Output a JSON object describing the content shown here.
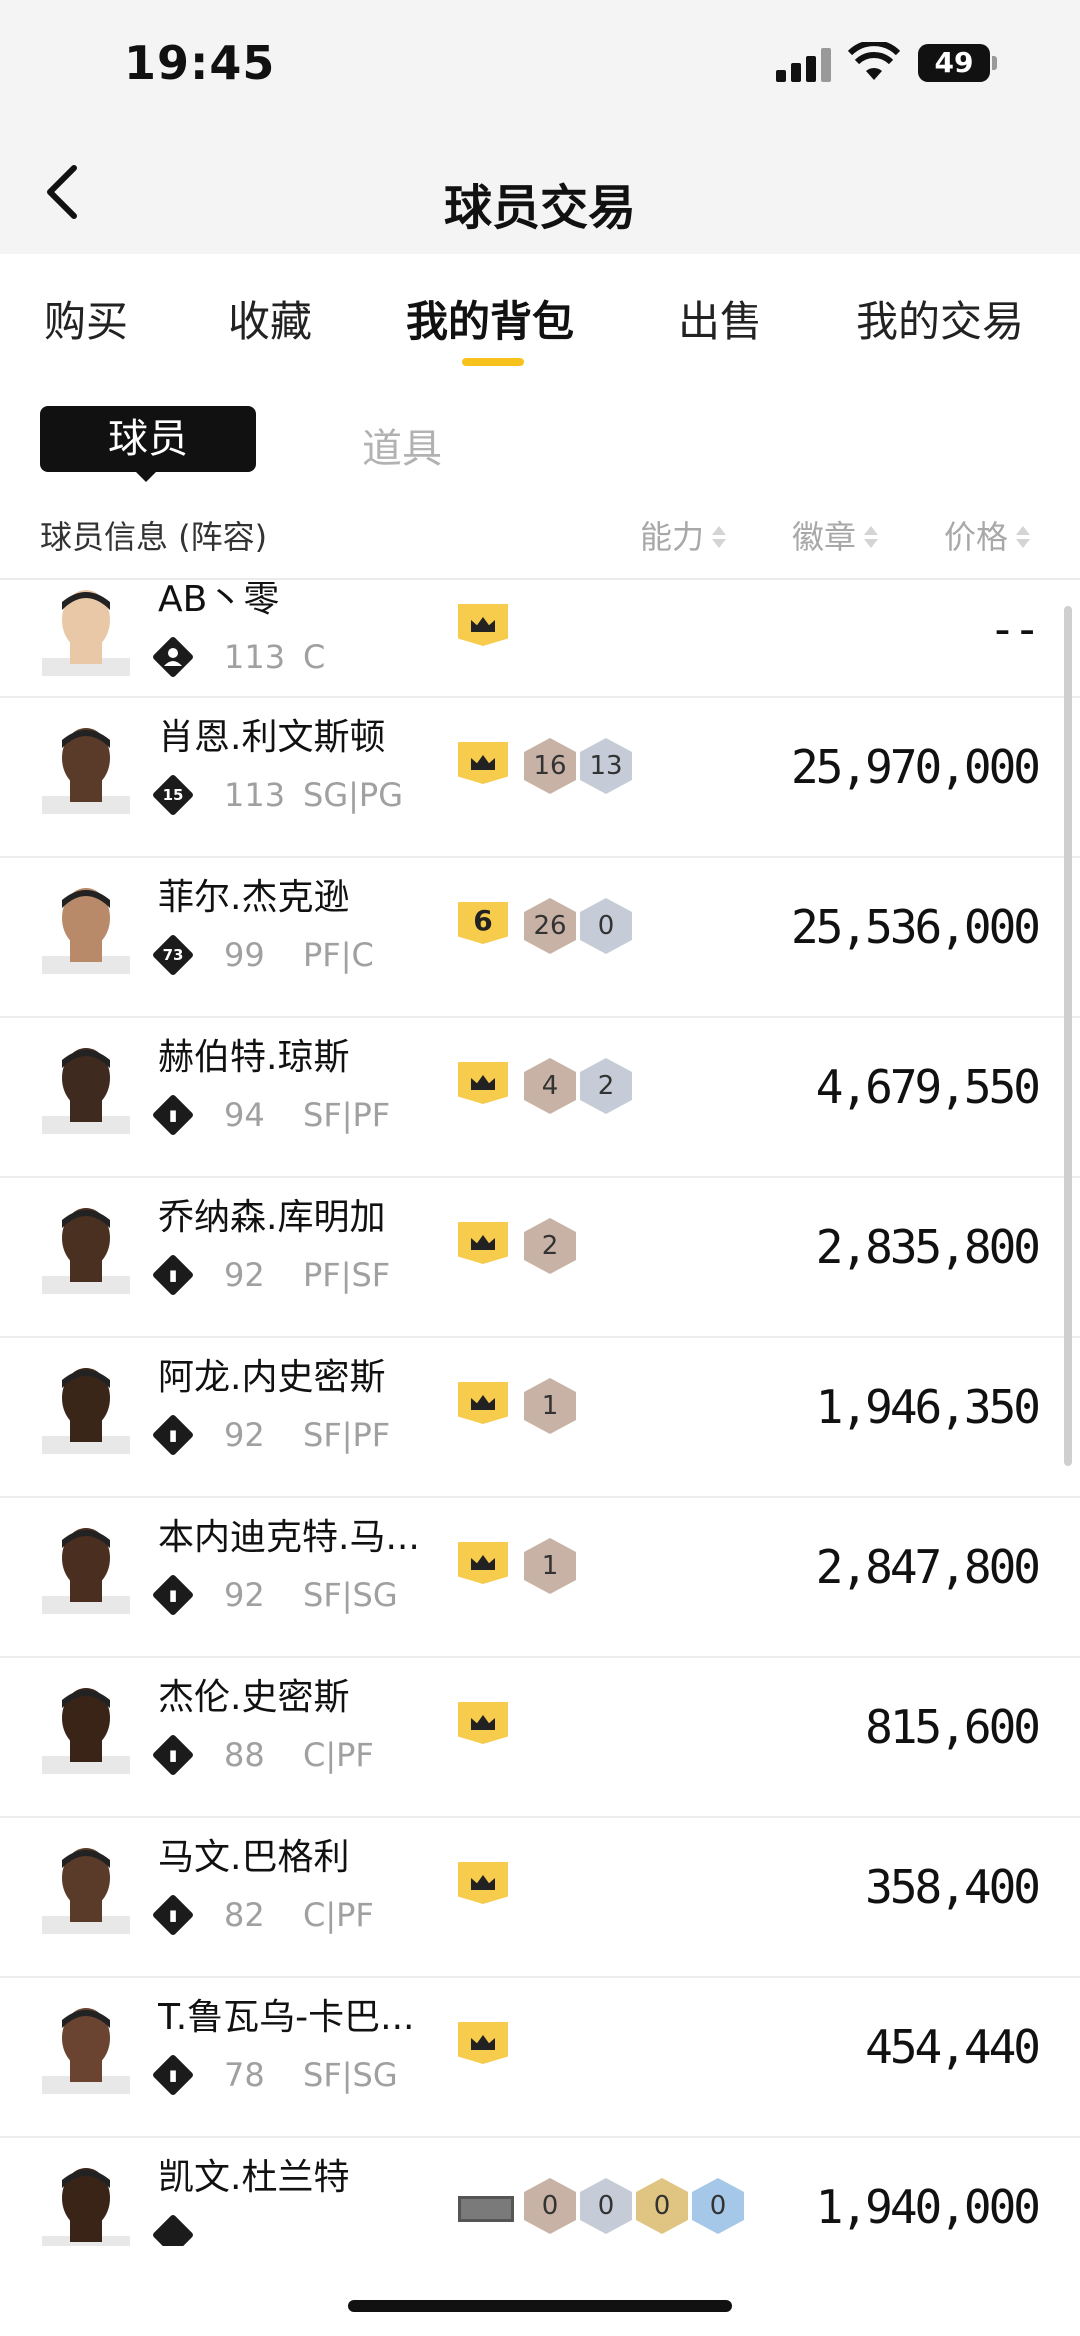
{
  "status": {
    "time": "19:45",
    "battery": "49"
  },
  "header": {
    "title": "球员交易"
  },
  "tabs": [
    "购买",
    "收藏",
    "我的背包",
    "出售",
    "我的交易"
  ],
  "subtabs": {
    "active": "球员",
    "inactive": "道具"
  },
  "columns": {
    "info": "球员信息 (阵容)",
    "ability": "能力",
    "badge": "徽章",
    "price": "价格"
  },
  "players": [
    {
      "name": "AB丶零",
      "icon": "person-icon",
      "glyph": "",
      "rating": "113",
      "pos": "C",
      "price": "--",
      "tier": "crown",
      "badges": []
    },
    {
      "name": "肖恩.利文斯顿",
      "icon": "tier-15-icon",
      "glyph": "15",
      "rating": "113",
      "pos": "SG|PG",
      "price": "25,970,000",
      "tier": "crown",
      "badges": [
        {
          "v": "16",
          "c": "bronze"
        },
        {
          "v": "13",
          "c": "silver"
        }
      ]
    },
    {
      "name": "菲尔.杰克逊",
      "icon": "tier-73-icon",
      "glyph": "73",
      "rating": "99",
      "pos": "PF|C",
      "price": "25,536,000",
      "tier": "6",
      "badges": [
        {
          "v": "26",
          "c": "bronze"
        },
        {
          "v": "0",
          "c": "silver"
        }
      ]
    },
    {
      "name": "赫伯特.琼斯",
      "icon": "bars-icon",
      "glyph": "▮",
      "rating": "94",
      "pos": "SF|PF",
      "price": "4,679,550",
      "tier": "crown",
      "badges": [
        {
          "v": "4",
          "c": "bronze"
        },
        {
          "v": "2",
          "c": "silver"
        }
      ]
    },
    {
      "name": "乔纳森.库明加",
      "icon": "bars-icon",
      "glyph": "▮",
      "rating": "92",
      "pos": "PF|SF",
      "price": "2,835,800",
      "tier": "crown",
      "badges": [
        {
          "v": "2",
          "c": "bronze"
        }
      ]
    },
    {
      "name": "阿龙.内史密斯",
      "icon": "bars-icon",
      "glyph": "▮",
      "rating": "92",
      "pos": "SF|PF",
      "price": "1,946,350",
      "tier": "crown",
      "badges": [
        {
          "v": "1",
          "c": "bronze"
        }
      ]
    },
    {
      "name": "本内迪克特.马...",
      "icon": "bars-icon",
      "glyph": "▮",
      "rating": "92",
      "pos": "SF|SG",
      "price": "2,847,800",
      "tier": "crown",
      "badges": [
        {
          "v": "1",
          "c": "bronze"
        }
      ]
    },
    {
      "name": "杰伦.史密斯",
      "icon": "bars-icon",
      "glyph": "▮",
      "rating": "88",
      "pos": "C|PF",
      "price": "815,600",
      "tier": "crown",
      "badges": []
    },
    {
      "name": "马文.巴格利",
      "icon": "bars-icon",
      "glyph": "▮",
      "rating": "82",
      "pos": "C|PF",
      "price": "358,400",
      "tier": "crown",
      "badges": []
    },
    {
      "name": "T.鲁瓦乌-卡巴...",
      "icon": "bars-icon",
      "glyph": "▮",
      "rating": "78",
      "pos": "SF|SG",
      "price": "454,440",
      "tier": "crown",
      "badges": []
    },
    {
      "name": "凯文.杜兰特",
      "icon": "bars-icon",
      "glyph": "",
      "rating": "",
      "pos": "",
      "price": "1,940,000",
      "tier": "gray",
      "badges": [
        {
          "v": "0",
          "c": "bronze"
        },
        {
          "v": "0",
          "c": "silver"
        },
        {
          "v": "0",
          "c": "gold"
        },
        {
          "v": "0",
          "c": "blue"
        }
      ]
    }
  ]
}
